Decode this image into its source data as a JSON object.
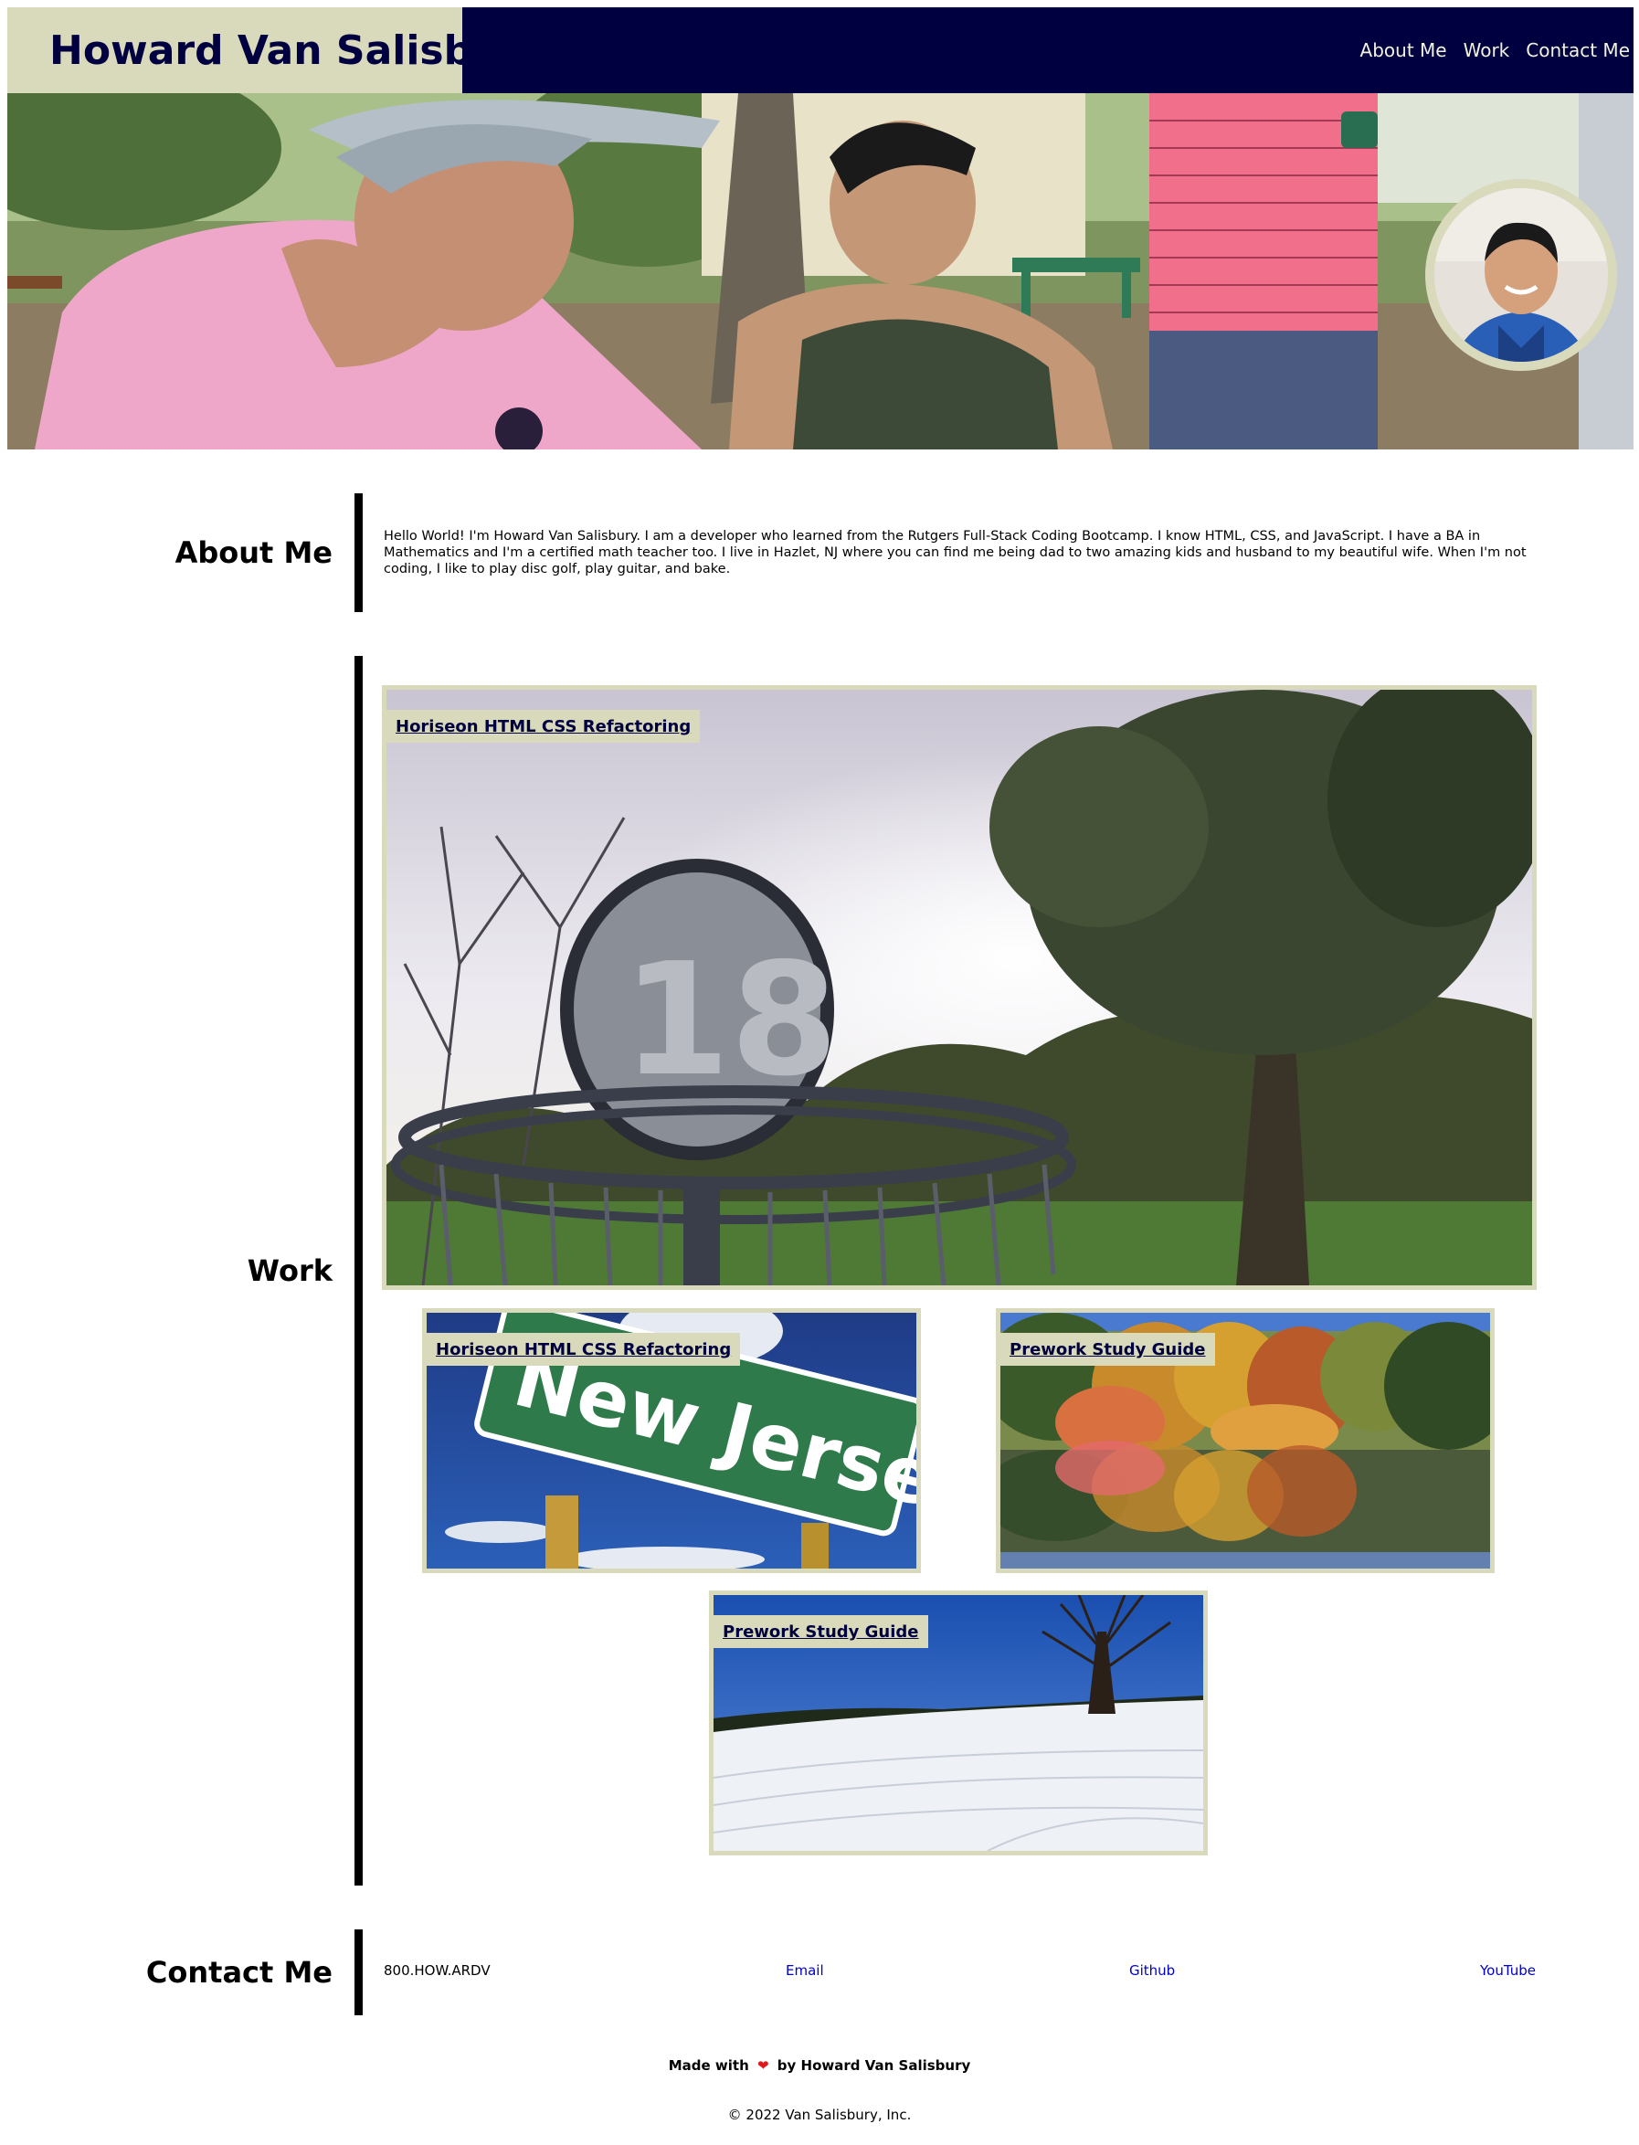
{
  "header": {
    "name": "Howard Van Salisbury",
    "nav": [
      {
        "label": "About Me"
      },
      {
        "label": "Work"
      },
      {
        "label": "Contact Me"
      }
    ]
  },
  "about": {
    "title": "About Me",
    "text": "Hello World! I'm Howard Van Salisbury. I am a developer who learned from the Rutgers Full-Stack Coding Bootcamp. I know HTML, CSS, and JavaScript. I have a BA in Mathematics and I'm a certified math teacher too. I live in Hazlet, NJ where you can find me being dad to two amazing kids and husband to my beautiful wife. When I'm not coding, I like to play disc golf, play guitar, and bake."
  },
  "work": {
    "title": "Work",
    "projects": [
      {
        "label": "Horiseon HTML CSS Refactoring"
      },
      {
        "label": "Horiseon HTML CSS Refactoring"
      },
      {
        "label": "Prework Study Guide"
      },
      {
        "label": "Prework Study Guide"
      }
    ]
  },
  "contact": {
    "title": "Contact Me",
    "phone": "800.HOW.ARDV",
    "links": [
      {
        "label": "Email"
      },
      {
        "label": "Github"
      },
      {
        "label": "YouTube"
      }
    ]
  },
  "footer": {
    "made_with_prefix": "Made with",
    "heart_icon": "heart-icon",
    "made_with_suffix": "by Howard Van Salisbury",
    "copyright": "© 2022 Van Salisbury, Inc."
  },
  "colors": {
    "navy": "#000040",
    "beige": "#d9d9bc",
    "link_blue": "#0000cc",
    "heart_red": "#e0181b"
  }
}
